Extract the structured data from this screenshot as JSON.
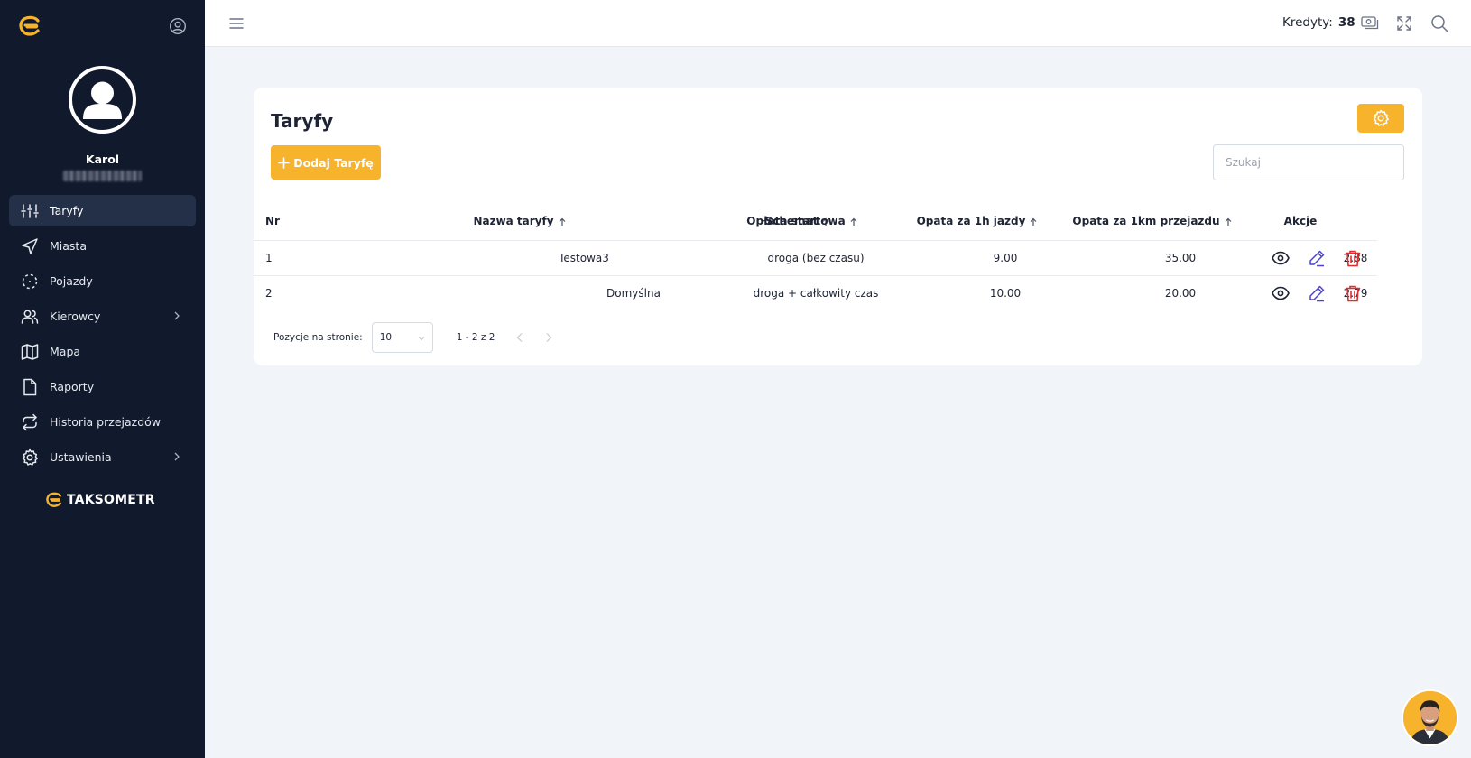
{
  "app": {
    "brand": "TAKSOMETR",
    "accent_color": "#f7b32b",
    "sidebar_color": "#111a2c"
  },
  "user": {
    "name": "Karol"
  },
  "sidebar": {
    "items": [
      {
        "label": "Taryfy",
        "icon": "sliders-icon",
        "active": true
      },
      {
        "label": "Miasta",
        "icon": "navigation-icon"
      },
      {
        "label": "Pojazdy",
        "icon": "dashed-circle-icon"
      },
      {
        "label": "Kierowcy",
        "icon": "users-icon",
        "has_submenu": true
      },
      {
        "label": "Mapa",
        "icon": "map-icon"
      },
      {
        "label": "Raporty",
        "icon": "file-icon"
      },
      {
        "label": "Historia przejazdów",
        "icon": "repeat-icon"
      },
      {
        "label": "Ustawienia",
        "icon": "gear-icon",
        "has_submenu": true
      }
    ]
  },
  "header": {
    "credits_label": "Kredyty:",
    "credits_value": "38"
  },
  "page": {
    "title": "Taryfy",
    "add_button": "Dodaj Taryfę",
    "search_placeholder": "Szukaj"
  },
  "table": {
    "columns": [
      "Nr",
      "Nazwa taryfy",
      "Schemat",
      "Opłata startowa",
      "Opata za 1h jazdy",
      "Opata za 1km przejazdu",
      "Akcje"
    ],
    "rows": [
      {
        "nr": "1",
        "name": "Testowa3",
        "schema": "droga (bez czasu)",
        "start": "9.00",
        "hour": "35.00",
        "km": "2.88"
      },
      {
        "nr": "2",
        "name": "Domyślna",
        "schema": "droga + całkowity czas",
        "start": "10.00",
        "hour": "20.00",
        "km": "2.79"
      }
    ]
  },
  "pagination": {
    "label": "Pozycje na stronie:",
    "page_size": "10",
    "range": "1 - 2 z 2"
  }
}
